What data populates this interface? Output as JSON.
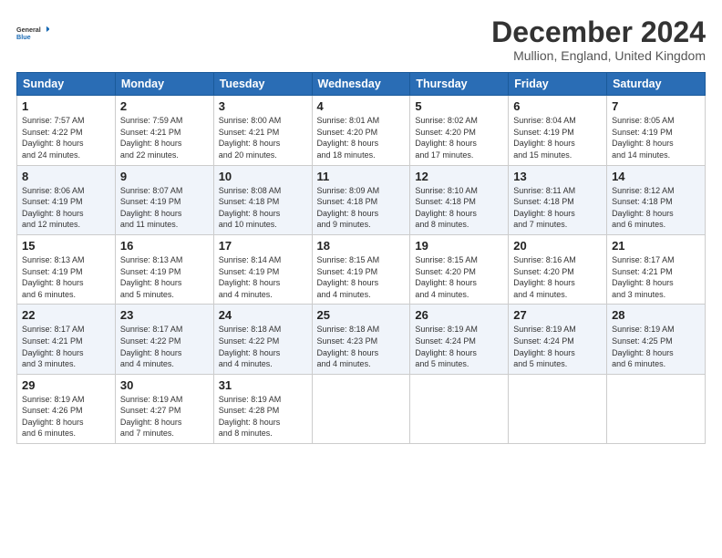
{
  "logo": {
    "line1": "General",
    "line2": "Blue"
  },
  "title": "December 2024",
  "subtitle": "Mullion, England, United Kingdom",
  "header_days": [
    "Sunday",
    "Monday",
    "Tuesday",
    "Wednesday",
    "Thursday",
    "Friday",
    "Saturday"
  ],
  "weeks": [
    [
      {
        "day": "1",
        "detail": "Sunrise: 7:57 AM\nSunset: 4:22 PM\nDaylight: 8 hours\nand 24 minutes."
      },
      {
        "day": "2",
        "detail": "Sunrise: 7:59 AM\nSunset: 4:21 PM\nDaylight: 8 hours\nand 22 minutes."
      },
      {
        "day": "3",
        "detail": "Sunrise: 8:00 AM\nSunset: 4:21 PM\nDaylight: 8 hours\nand 20 minutes."
      },
      {
        "day": "4",
        "detail": "Sunrise: 8:01 AM\nSunset: 4:20 PM\nDaylight: 8 hours\nand 18 minutes."
      },
      {
        "day": "5",
        "detail": "Sunrise: 8:02 AM\nSunset: 4:20 PM\nDaylight: 8 hours\nand 17 minutes."
      },
      {
        "day": "6",
        "detail": "Sunrise: 8:04 AM\nSunset: 4:19 PM\nDaylight: 8 hours\nand 15 minutes."
      },
      {
        "day": "7",
        "detail": "Sunrise: 8:05 AM\nSunset: 4:19 PM\nDaylight: 8 hours\nand 14 minutes."
      }
    ],
    [
      {
        "day": "8",
        "detail": "Sunrise: 8:06 AM\nSunset: 4:19 PM\nDaylight: 8 hours\nand 12 minutes."
      },
      {
        "day": "9",
        "detail": "Sunrise: 8:07 AM\nSunset: 4:19 PM\nDaylight: 8 hours\nand 11 minutes."
      },
      {
        "day": "10",
        "detail": "Sunrise: 8:08 AM\nSunset: 4:18 PM\nDaylight: 8 hours\nand 10 minutes."
      },
      {
        "day": "11",
        "detail": "Sunrise: 8:09 AM\nSunset: 4:18 PM\nDaylight: 8 hours\nand 9 minutes."
      },
      {
        "day": "12",
        "detail": "Sunrise: 8:10 AM\nSunset: 4:18 PM\nDaylight: 8 hours\nand 8 minutes."
      },
      {
        "day": "13",
        "detail": "Sunrise: 8:11 AM\nSunset: 4:18 PM\nDaylight: 8 hours\nand 7 minutes."
      },
      {
        "day": "14",
        "detail": "Sunrise: 8:12 AM\nSunset: 4:18 PM\nDaylight: 8 hours\nand 6 minutes."
      }
    ],
    [
      {
        "day": "15",
        "detail": "Sunrise: 8:13 AM\nSunset: 4:19 PM\nDaylight: 8 hours\nand 6 minutes."
      },
      {
        "day": "16",
        "detail": "Sunrise: 8:13 AM\nSunset: 4:19 PM\nDaylight: 8 hours\nand 5 minutes."
      },
      {
        "day": "17",
        "detail": "Sunrise: 8:14 AM\nSunset: 4:19 PM\nDaylight: 8 hours\nand 4 minutes."
      },
      {
        "day": "18",
        "detail": "Sunrise: 8:15 AM\nSunset: 4:19 PM\nDaylight: 8 hours\nand 4 minutes."
      },
      {
        "day": "19",
        "detail": "Sunrise: 8:15 AM\nSunset: 4:20 PM\nDaylight: 8 hours\nand 4 minutes."
      },
      {
        "day": "20",
        "detail": "Sunrise: 8:16 AM\nSunset: 4:20 PM\nDaylight: 8 hours\nand 4 minutes."
      },
      {
        "day": "21",
        "detail": "Sunrise: 8:17 AM\nSunset: 4:21 PM\nDaylight: 8 hours\nand 3 minutes."
      }
    ],
    [
      {
        "day": "22",
        "detail": "Sunrise: 8:17 AM\nSunset: 4:21 PM\nDaylight: 8 hours\nand 3 minutes."
      },
      {
        "day": "23",
        "detail": "Sunrise: 8:17 AM\nSunset: 4:22 PM\nDaylight: 8 hours\nand 4 minutes."
      },
      {
        "day": "24",
        "detail": "Sunrise: 8:18 AM\nSunset: 4:22 PM\nDaylight: 8 hours\nand 4 minutes."
      },
      {
        "day": "25",
        "detail": "Sunrise: 8:18 AM\nSunset: 4:23 PM\nDaylight: 8 hours\nand 4 minutes."
      },
      {
        "day": "26",
        "detail": "Sunrise: 8:19 AM\nSunset: 4:24 PM\nDaylight: 8 hours\nand 5 minutes."
      },
      {
        "day": "27",
        "detail": "Sunrise: 8:19 AM\nSunset: 4:24 PM\nDaylight: 8 hours\nand 5 minutes."
      },
      {
        "day": "28",
        "detail": "Sunrise: 8:19 AM\nSunset: 4:25 PM\nDaylight: 8 hours\nand 6 minutes."
      }
    ],
    [
      {
        "day": "29",
        "detail": "Sunrise: 8:19 AM\nSunset: 4:26 PM\nDaylight: 8 hours\nand 6 minutes."
      },
      {
        "day": "30",
        "detail": "Sunrise: 8:19 AM\nSunset: 4:27 PM\nDaylight: 8 hours\nand 7 minutes."
      },
      {
        "day": "31",
        "detail": "Sunrise: 8:19 AM\nSunset: 4:28 PM\nDaylight: 8 hours\nand 8 minutes."
      },
      null,
      null,
      null,
      null
    ]
  ]
}
